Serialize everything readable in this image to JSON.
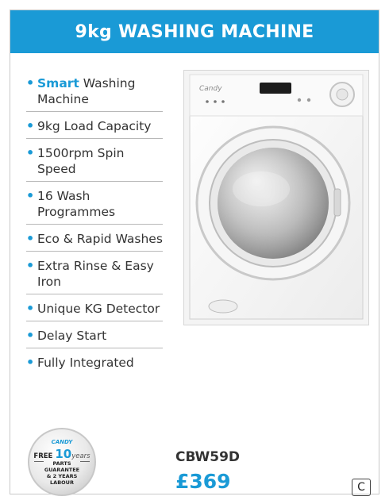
{
  "header": {
    "title": "9kg WASHING MACHINE"
  },
  "features": [
    {
      "highlight": "Smart",
      "text": " Washing Machine"
    },
    {
      "highlight": "",
      "text": "9kg Load Capacity"
    },
    {
      "highlight": "",
      "text": "1500rpm Spin Speed"
    },
    {
      "highlight": "",
      "text": "16 Wash Programmes"
    },
    {
      "highlight": "",
      "text": "Eco & Rapid Washes"
    },
    {
      "highlight": "",
      "text": "Extra Rinse & Easy Iron"
    },
    {
      "highlight": "",
      "text": "Unique KG Detector"
    },
    {
      "highlight": "",
      "text": "Delay Start"
    },
    {
      "highlight": "",
      "text": "Fully Integrated"
    }
  ],
  "badge": {
    "brand": "CANDY",
    "free": "FREE",
    "years_num": "10",
    "years_word": "years",
    "line1": "PARTS",
    "line2": "GUARANTEE",
    "line3": "& 2 YEARS",
    "line4": "LABOUR"
  },
  "product": {
    "model": "CBW59D",
    "price": "£369",
    "energy_class": "C"
  },
  "colors": {
    "accent": "#1a9ad6",
    "text": "#333333"
  }
}
